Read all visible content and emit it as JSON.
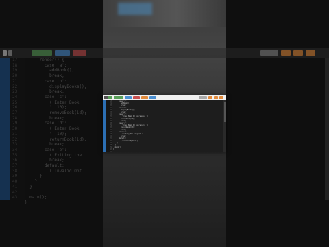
{
  "background_editor": {
    "code_lines": [
      "      render() {",
      "        case 'a':",
      "          addBook();",
      "          break;",
      "        case 'b':",
      "          displayBooks();",
      "          break;",
      "        case 'c':",
      "          ('Enter Book",
      "          ', 10);",
      "          removeBook(id);",
      "          break;",
      "        case 'd':",
      "          ('Enter Book",
      "          ', 10);",
      "          returnBook(id);",
      "          break;",
      "        case 'e':",
      "          ('Exiting the",
      "          break;",
      "        default:",
      "          ('Invalid Opt",
      "      }",
      "    }",
      "  }",
      "",
      "  main();",
      "}"
    ],
    "line_numbers": [
      "17",
      "18",
      "19",
      "20",
      "21",
      "22",
      "23",
      "24",
      "25",
      "26",
      "27",
      "28",
      "29",
      "30",
      "31",
      "32",
      "33",
      "34",
      "35",
      "36",
      "37",
      "38",
      "39",
      "40",
      "41",
      "42",
      "43"
    ]
  },
  "editor_window": {
    "line_numbers": [
      "18",
      "19",
      "20",
      "21",
      "22",
      "23",
      "24",
      "25",
      "26",
      "27",
      "28",
      "29",
      "30",
      "31",
      "32",
      "33",
      "34",
      "35",
      "36",
      "37",
      "38",
      "39",
      "40",
      "41"
    ],
    "code_lines": [
      "      case 'a':",
      "        addBook();",
      "        break;",
      "      case 'b':",
      "        displayBooks();",
      "        break;",
      "      case 'c':",
      "        ('Enter Book ID to remove: ')",
      "        removeBook(id);",
      "        break;",
      "      case 'd':",
      "        ('Enter Book ID to return: ')",
      "        returnBook(id);",
      "        break;",
      "      case 'e':",
      "        ('Exiting the program.')",
      "        break;",
      "      default:",
      "        ('Invalid Option')",
      "    }",
      "  }",
      "  main();",
      "}",
      ""
    ]
  },
  "colors": {
    "gutter_blue": "#2c6fb4",
    "tab_green": "#5aa05a",
    "tab_blue": "#4b8fd1",
    "tab_orange": "#e08a3c",
    "tab_red": "#c85050"
  }
}
